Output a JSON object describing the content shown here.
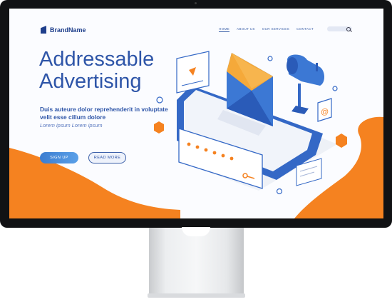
{
  "brand": {
    "name": "BrandName"
  },
  "nav": {
    "items": [
      {
        "label": "HOME",
        "active": true
      },
      {
        "label": "ABOUT US",
        "active": false
      },
      {
        "label": "OUR SERVICES",
        "active": false
      },
      {
        "label": "CONTACT",
        "active": false
      }
    ]
  },
  "hero": {
    "title_line1": "Addressable",
    "title_line2": "Advertising",
    "subtitle": "Duis auteure dolor reprehenderit in voluptate velit esse cillum dolore",
    "tagline": "Lorem ipsum Lorem ipsum",
    "signup_label": "SIGN UP",
    "read_more_label": "READ MORE"
  },
  "colors": {
    "accent_blue": "#2e55a8",
    "accent_orange": "#f58220",
    "bezel": "#111214"
  }
}
